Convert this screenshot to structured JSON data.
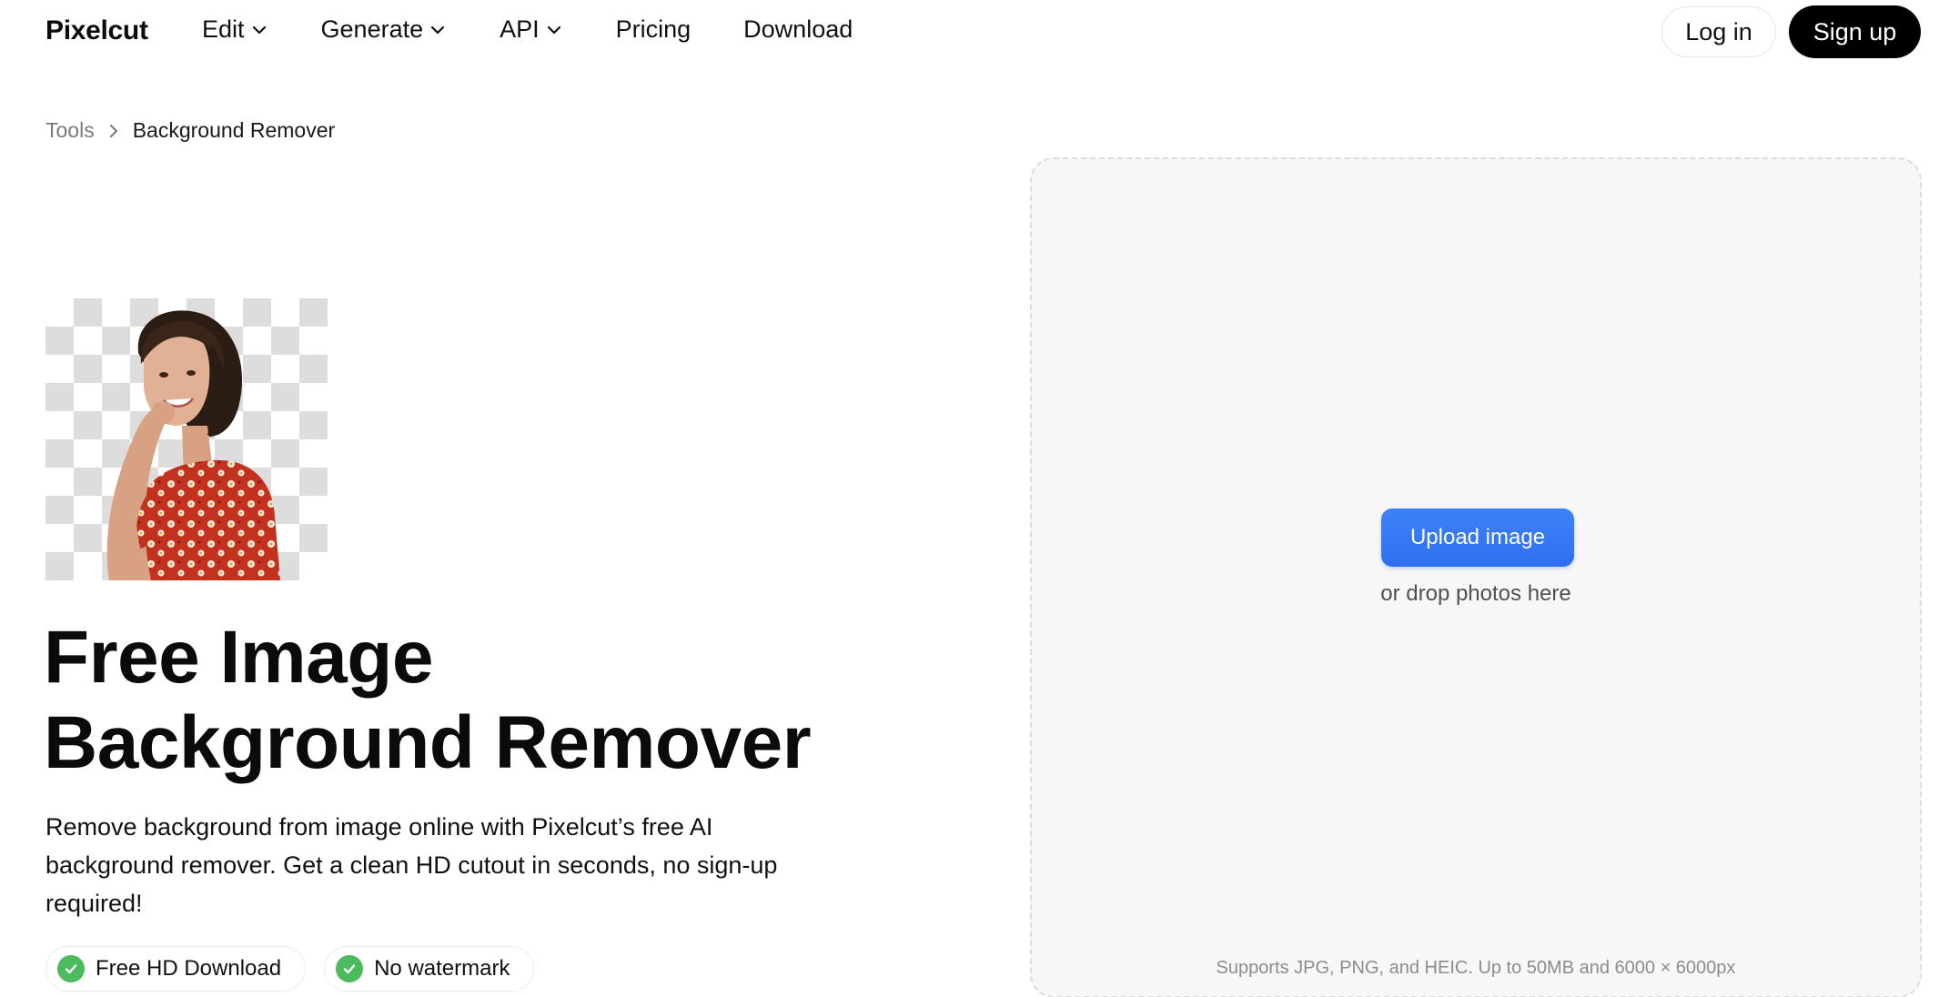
{
  "header": {
    "logo": "Pixelcut",
    "nav": [
      {
        "label": "Edit",
        "has_dropdown": true
      },
      {
        "label": "Generate",
        "has_dropdown": true
      },
      {
        "label": "API",
        "has_dropdown": true
      },
      {
        "label": "Pricing",
        "has_dropdown": false
      },
      {
        "label": "Download",
        "has_dropdown": false
      }
    ],
    "login_label": "Log in",
    "signup_label": "Sign up"
  },
  "breadcrumb": {
    "parent": "Tools",
    "current": "Background Remover"
  },
  "hero": {
    "title_line1": "Free Image",
    "title_line2": "Background Remover",
    "description": "Remove background from image online with Pixelcut’s free AI background remover. Get a clean HD cutout in seconds, no sign-up required!",
    "features": [
      {
        "label": "Free HD Download",
        "icon": "check-icon"
      },
      {
        "label": "No watermark",
        "icon": "check-icon"
      }
    ]
  },
  "upload": {
    "button_label": "Upload image",
    "drop_text": "or drop photos here",
    "support_text": "Supports JPG, PNG, and HEIC. Up to 50MB and 6000 × 6000px"
  },
  "colors": {
    "primary_button": "#3478f6",
    "signup_bg": "#000000",
    "check_green": "#4cbb5e",
    "panel_bg": "#f7f7f7"
  }
}
